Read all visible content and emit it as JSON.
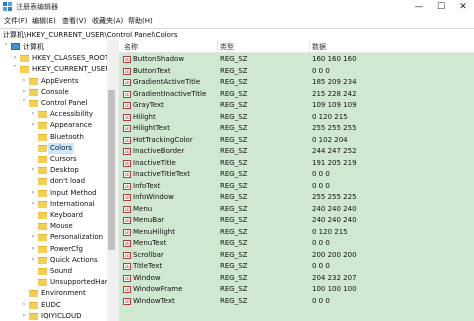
{
  "window": {
    "title": "注册表编辑器",
    "minimize": "—",
    "maximize": "☐",
    "close": "✕"
  },
  "menu": [
    "文件(F)",
    "编辑(E)",
    "查看(V)",
    "收藏夹(A)",
    "帮助(H)"
  ],
  "address": "计算机\\HKEY_CURRENT_USER\\Control Panel\\Colors",
  "tree": [
    {
      "label": "计算机",
      "level": 0,
      "exp": "˅",
      "icon": "pc"
    },
    {
      "label": "HKEY_CLASSES_ROOT",
      "level": 1,
      "exp": "›",
      "icon": "folder"
    },
    {
      "label": "HKEY_CURRENT_USER",
      "level": 1,
      "exp": "˅",
      "icon": "folder"
    },
    {
      "label": "AppEvents",
      "level": 2,
      "exp": "›",
      "icon": "folder"
    },
    {
      "label": "Console",
      "level": 2,
      "exp": "›",
      "icon": "folder"
    },
    {
      "label": "Control Panel",
      "level": 2,
      "exp": "˅",
      "icon": "folder"
    },
    {
      "label": "Accessibility",
      "level": 3,
      "exp": "›",
      "icon": "folder"
    },
    {
      "label": "Appearance",
      "level": 3,
      "exp": "›",
      "icon": "folder"
    },
    {
      "label": "Bluetooth",
      "level": 3,
      "exp": "",
      "icon": "folder"
    },
    {
      "label": "Colors",
      "level": 3,
      "exp": "",
      "icon": "folder",
      "selected": true
    },
    {
      "label": "Cursors",
      "level": 3,
      "exp": "",
      "icon": "folder"
    },
    {
      "label": "Desktop",
      "level": 3,
      "exp": "›",
      "icon": "folder"
    },
    {
      "label": "don't load",
      "level": 3,
      "exp": "",
      "icon": "folder"
    },
    {
      "label": "Input Method",
      "level": 3,
      "exp": "›",
      "icon": "folder"
    },
    {
      "label": "International",
      "level": 3,
      "exp": "›",
      "icon": "folder"
    },
    {
      "label": "Keyboard",
      "level": 3,
      "exp": "",
      "icon": "folder"
    },
    {
      "label": "Mouse",
      "level": 3,
      "exp": "",
      "icon": "folder"
    },
    {
      "label": "Personalization",
      "level": 3,
      "exp": "›",
      "icon": "folder"
    },
    {
      "label": "PowerCfg",
      "level": 3,
      "exp": "›",
      "icon": "folder"
    },
    {
      "label": "Quick Actions",
      "level": 3,
      "exp": "›",
      "icon": "folder"
    },
    {
      "label": "Sound",
      "level": 3,
      "exp": "",
      "icon": "folder"
    },
    {
      "label": "UnsupportedHard",
      "level": 3,
      "exp": "",
      "icon": "folder"
    },
    {
      "label": "Environment",
      "level": 2,
      "exp": "",
      "icon": "folder"
    },
    {
      "label": "EUDC",
      "level": 2,
      "exp": "›",
      "icon": "folder"
    },
    {
      "label": "IQIYICLOUD",
      "level": 2,
      "exp": "›",
      "icon": "folder"
    }
  ],
  "columns": {
    "name": "名称",
    "type": "类型",
    "data": "数据"
  },
  "values": [
    {
      "name": "ButtonShadow",
      "type": "REG_SZ",
      "data": "160 160 160"
    },
    {
      "name": "ButtonText",
      "type": "REG_SZ",
      "data": "0 0 0"
    },
    {
      "name": "GradientActiveTitle",
      "type": "REG_SZ",
      "data": "185 209 234"
    },
    {
      "name": "GradientInactiveTitle",
      "type": "REG_SZ",
      "data": "215 228 242"
    },
    {
      "name": "GrayText",
      "type": "REG_SZ",
      "data": "109 109 109"
    },
    {
      "name": "Hilight",
      "type": "REG_SZ",
      "data": "0 120 215"
    },
    {
      "name": "HilightText",
      "type": "REG_SZ",
      "data": "255 255 255"
    },
    {
      "name": "HotTrackingColor",
      "type": "REG_SZ",
      "data": "0 102 204"
    },
    {
      "name": "InactiveBorder",
      "type": "REG_SZ",
      "data": "244 247 252"
    },
    {
      "name": "InactiveTitle",
      "type": "REG_SZ",
      "data": "191 205 219"
    },
    {
      "name": "InactiveTitleText",
      "type": "REG_SZ",
      "data": "0 0 0"
    },
    {
      "name": "InfoText",
      "type": "REG_SZ",
      "data": "0 0 0"
    },
    {
      "name": "InfoWindow",
      "type": "REG_SZ",
      "data": "255 255 225"
    },
    {
      "name": "Menu",
      "type": "REG_SZ",
      "data": "240 240 240"
    },
    {
      "name": "MenuBar",
      "type": "REG_SZ",
      "data": "240 240 240"
    },
    {
      "name": "MenuHilight",
      "type": "REG_SZ",
      "data": "0 120 215"
    },
    {
      "name": "MenuText",
      "type": "REG_SZ",
      "data": "0 0 0"
    },
    {
      "name": "Scrollbar",
      "type": "REG_SZ",
      "data": "200 200 200"
    },
    {
      "name": "TitleText",
      "type": "REG_SZ",
      "data": "0 0 0"
    },
    {
      "name": "Window",
      "type": "REG_SZ",
      "data": "204 232 207"
    },
    {
      "name": "WindowFrame",
      "type": "REG_SZ",
      "data": "100 100 100"
    },
    {
      "name": "WindowText",
      "type": "REG_SZ",
      "data": "0 0 0"
    }
  ],
  "colors": {
    "list_bg": "#cfe8cf",
    "selection": "#cce8ff",
    "folder": "#f3cf5a"
  }
}
